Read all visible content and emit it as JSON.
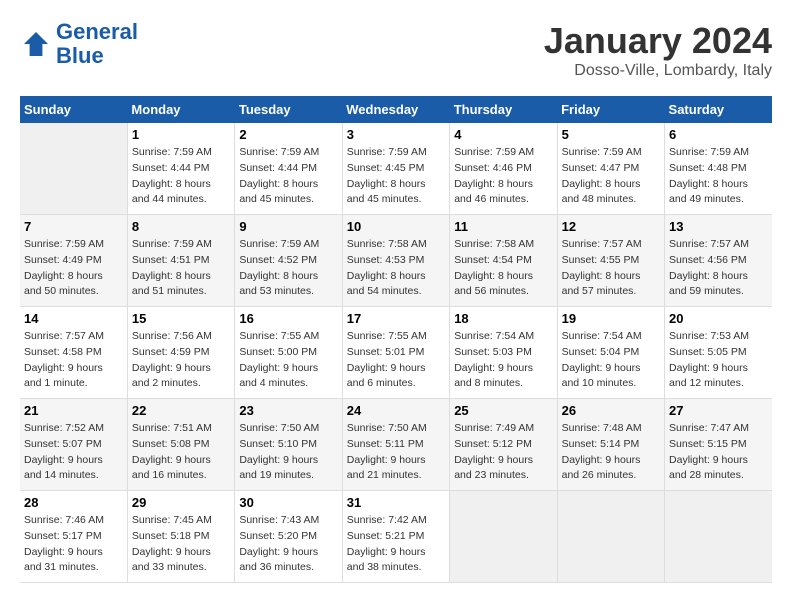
{
  "logo": {
    "line1": "General",
    "line2": "Blue"
  },
  "title": "January 2024",
  "subtitle": "Dosso-Ville, Lombardy, Italy",
  "days_of_week": [
    "Sunday",
    "Monday",
    "Tuesday",
    "Wednesday",
    "Thursday",
    "Friday",
    "Saturday"
  ],
  "weeks": [
    [
      {
        "day": "",
        "info": ""
      },
      {
        "day": "1",
        "info": "Sunrise: 7:59 AM\nSunset: 4:44 PM\nDaylight: 8 hours\nand 44 minutes."
      },
      {
        "day": "2",
        "info": "Sunrise: 7:59 AM\nSunset: 4:44 PM\nDaylight: 8 hours\nand 45 minutes."
      },
      {
        "day": "3",
        "info": "Sunrise: 7:59 AM\nSunset: 4:45 PM\nDaylight: 8 hours\nand 45 minutes."
      },
      {
        "day": "4",
        "info": "Sunrise: 7:59 AM\nSunset: 4:46 PM\nDaylight: 8 hours\nand 46 minutes."
      },
      {
        "day": "5",
        "info": "Sunrise: 7:59 AM\nSunset: 4:47 PM\nDaylight: 8 hours\nand 48 minutes."
      },
      {
        "day": "6",
        "info": "Sunrise: 7:59 AM\nSunset: 4:48 PM\nDaylight: 8 hours\nand 49 minutes."
      }
    ],
    [
      {
        "day": "7",
        "info": "Sunrise: 7:59 AM\nSunset: 4:49 PM\nDaylight: 8 hours\nand 50 minutes."
      },
      {
        "day": "8",
        "info": "Sunrise: 7:59 AM\nSunset: 4:51 PM\nDaylight: 8 hours\nand 51 minutes."
      },
      {
        "day": "9",
        "info": "Sunrise: 7:59 AM\nSunset: 4:52 PM\nDaylight: 8 hours\nand 53 minutes."
      },
      {
        "day": "10",
        "info": "Sunrise: 7:58 AM\nSunset: 4:53 PM\nDaylight: 8 hours\nand 54 minutes."
      },
      {
        "day": "11",
        "info": "Sunrise: 7:58 AM\nSunset: 4:54 PM\nDaylight: 8 hours\nand 56 minutes."
      },
      {
        "day": "12",
        "info": "Sunrise: 7:57 AM\nSunset: 4:55 PM\nDaylight: 8 hours\nand 57 minutes."
      },
      {
        "day": "13",
        "info": "Sunrise: 7:57 AM\nSunset: 4:56 PM\nDaylight: 8 hours\nand 59 minutes."
      }
    ],
    [
      {
        "day": "14",
        "info": "Sunrise: 7:57 AM\nSunset: 4:58 PM\nDaylight: 9 hours\nand 1 minute."
      },
      {
        "day": "15",
        "info": "Sunrise: 7:56 AM\nSunset: 4:59 PM\nDaylight: 9 hours\nand 2 minutes."
      },
      {
        "day": "16",
        "info": "Sunrise: 7:55 AM\nSunset: 5:00 PM\nDaylight: 9 hours\nand 4 minutes."
      },
      {
        "day": "17",
        "info": "Sunrise: 7:55 AM\nSunset: 5:01 PM\nDaylight: 9 hours\nand 6 minutes."
      },
      {
        "day": "18",
        "info": "Sunrise: 7:54 AM\nSunset: 5:03 PM\nDaylight: 9 hours\nand 8 minutes."
      },
      {
        "day": "19",
        "info": "Sunrise: 7:54 AM\nSunset: 5:04 PM\nDaylight: 9 hours\nand 10 minutes."
      },
      {
        "day": "20",
        "info": "Sunrise: 7:53 AM\nSunset: 5:05 PM\nDaylight: 9 hours\nand 12 minutes."
      }
    ],
    [
      {
        "day": "21",
        "info": "Sunrise: 7:52 AM\nSunset: 5:07 PM\nDaylight: 9 hours\nand 14 minutes."
      },
      {
        "day": "22",
        "info": "Sunrise: 7:51 AM\nSunset: 5:08 PM\nDaylight: 9 hours\nand 16 minutes."
      },
      {
        "day": "23",
        "info": "Sunrise: 7:50 AM\nSunset: 5:10 PM\nDaylight: 9 hours\nand 19 minutes."
      },
      {
        "day": "24",
        "info": "Sunrise: 7:50 AM\nSunset: 5:11 PM\nDaylight: 9 hours\nand 21 minutes."
      },
      {
        "day": "25",
        "info": "Sunrise: 7:49 AM\nSunset: 5:12 PM\nDaylight: 9 hours\nand 23 minutes."
      },
      {
        "day": "26",
        "info": "Sunrise: 7:48 AM\nSunset: 5:14 PM\nDaylight: 9 hours\nand 26 minutes."
      },
      {
        "day": "27",
        "info": "Sunrise: 7:47 AM\nSunset: 5:15 PM\nDaylight: 9 hours\nand 28 minutes."
      }
    ],
    [
      {
        "day": "28",
        "info": "Sunrise: 7:46 AM\nSunset: 5:17 PM\nDaylight: 9 hours\nand 31 minutes."
      },
      {
        "day": "29",
        "info": "Sunrise: 7:45 AM\nSunset: 5:18 PM\nDaylight: 9 hours\nand 33 minutes."
      },
      {
        "day": "30",
        "info": "Sunrise: 7:43 AM\nSunset: 5:20 PM\nDaylight: 9 hours\nand 36 minutes."
      },
      {
        "day": "31",
        "info": "Sunrise: 7:42 AM\nSunset: 5:21 PM\nDaylight: 9 hours\nand 38 minutes."
      },
      {
        "day": "",
        "info": ""
      },
      {
        "day": "",
        "info": ""
      },
      {
        "day": "",
        "info": ""
      }
    ]
  ]
}
